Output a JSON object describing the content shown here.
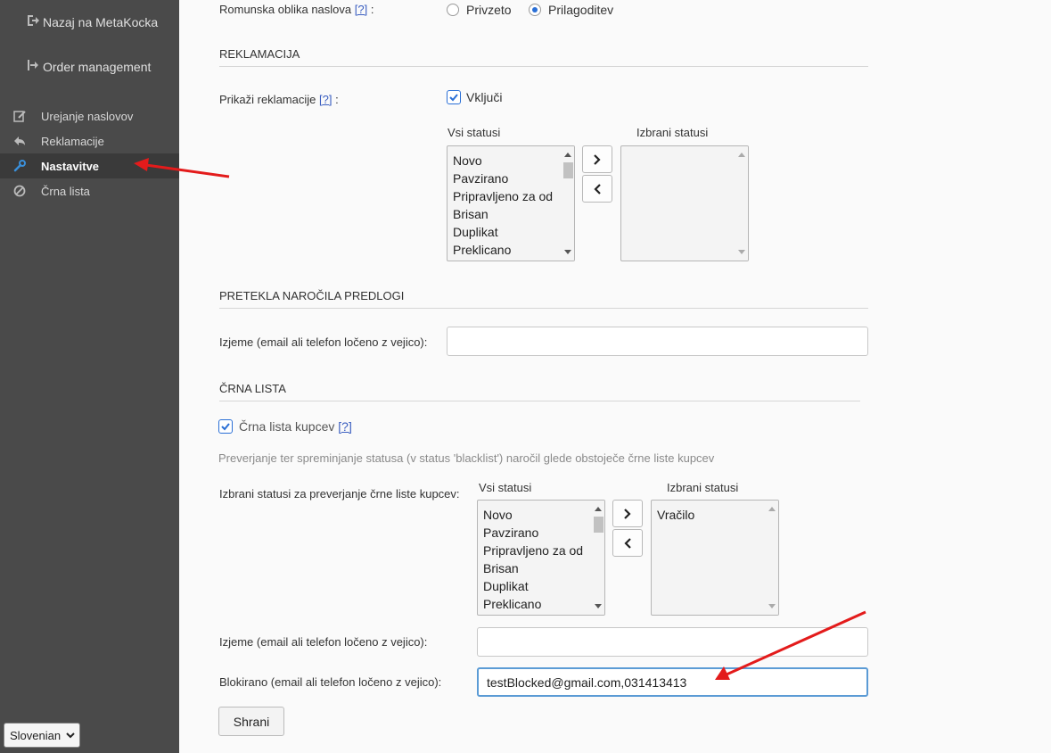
{
  "sidebar": {
    "back_link": "Nazaj na MetaKocka",
    "order_link": "Order management",
    "items": [
      {
        "label": "Urejanje naslovov",
        "icon": "edit-icon"
      },
      {
        "label": "Reklamacije",
        "icon": "reply-icon"
      },
      {
        "label": "Nastavitve",
        "icon": "wrench-icon",
        "active": true
      },
      {
        "label": "Črna lista",
        "icon": "ban-icon"
      }
    ],
    "language": "Slovenian"
  },
  "form": {
    "romanian_label": "Romunska oblika naslova",
    "help": "[?]",
    "colon": ":",
    "radio_default": "Privzeto",
    "radio_custom": "Prilagoditev",
    "section_complaints": "REKLAMACIJA",
    "show_complaints_label": "Prikaži reklamacije",
    "enable_label": "Vključi",
    "all_statuses": "Vsi statusi",
    "selected_statuses": "Izbrani statusi",
    "statuses": [
      "Novo",
      "Pavzirano",
      "Pripravljeno za od",
      "Brisan",
      "Duplikat",
      "Preklicano"
    ],
    "section_expired": "PRETEKLA NAROČILA PREDLOGI",
    "exceptions_label": "Izjeme (email ali telefon ločeno z vejico):",
    "exceptions_value": "",
    "section_blacklist": "ČRNA LISTA",
    "blacklist_customers_label": "Črna lista kupcev",
    "blacklist_hint": "Preverjanje ter spreminjanje statusa (v status 'blacklist') naročil glede obstoječe črne liste kupcev",
    "blacklist_statuses_label": "Izbrani statusi za preverjanje črne liste kupcev:",
    "blacklist_selected": [
      "Vračilo"
    ],
    "blacklist_exceptions_label": "Izjeme (email ali telefon ločeno z vejico):",
    "blacklist_exceptions_value": "",
    "blocked_label": "Blokirano (email ali telefon ločeno z vejico):",
    "blocked_value": "testBlocked@gmail.com,031413413",
    "save_button": "Shrani"
  },
  "colors": {
    "sidebar_bg": "#4a4a4a",
    "accent": "#2a6fd6",
    "annotation_arrow": "#e31b1b"
  }
}
